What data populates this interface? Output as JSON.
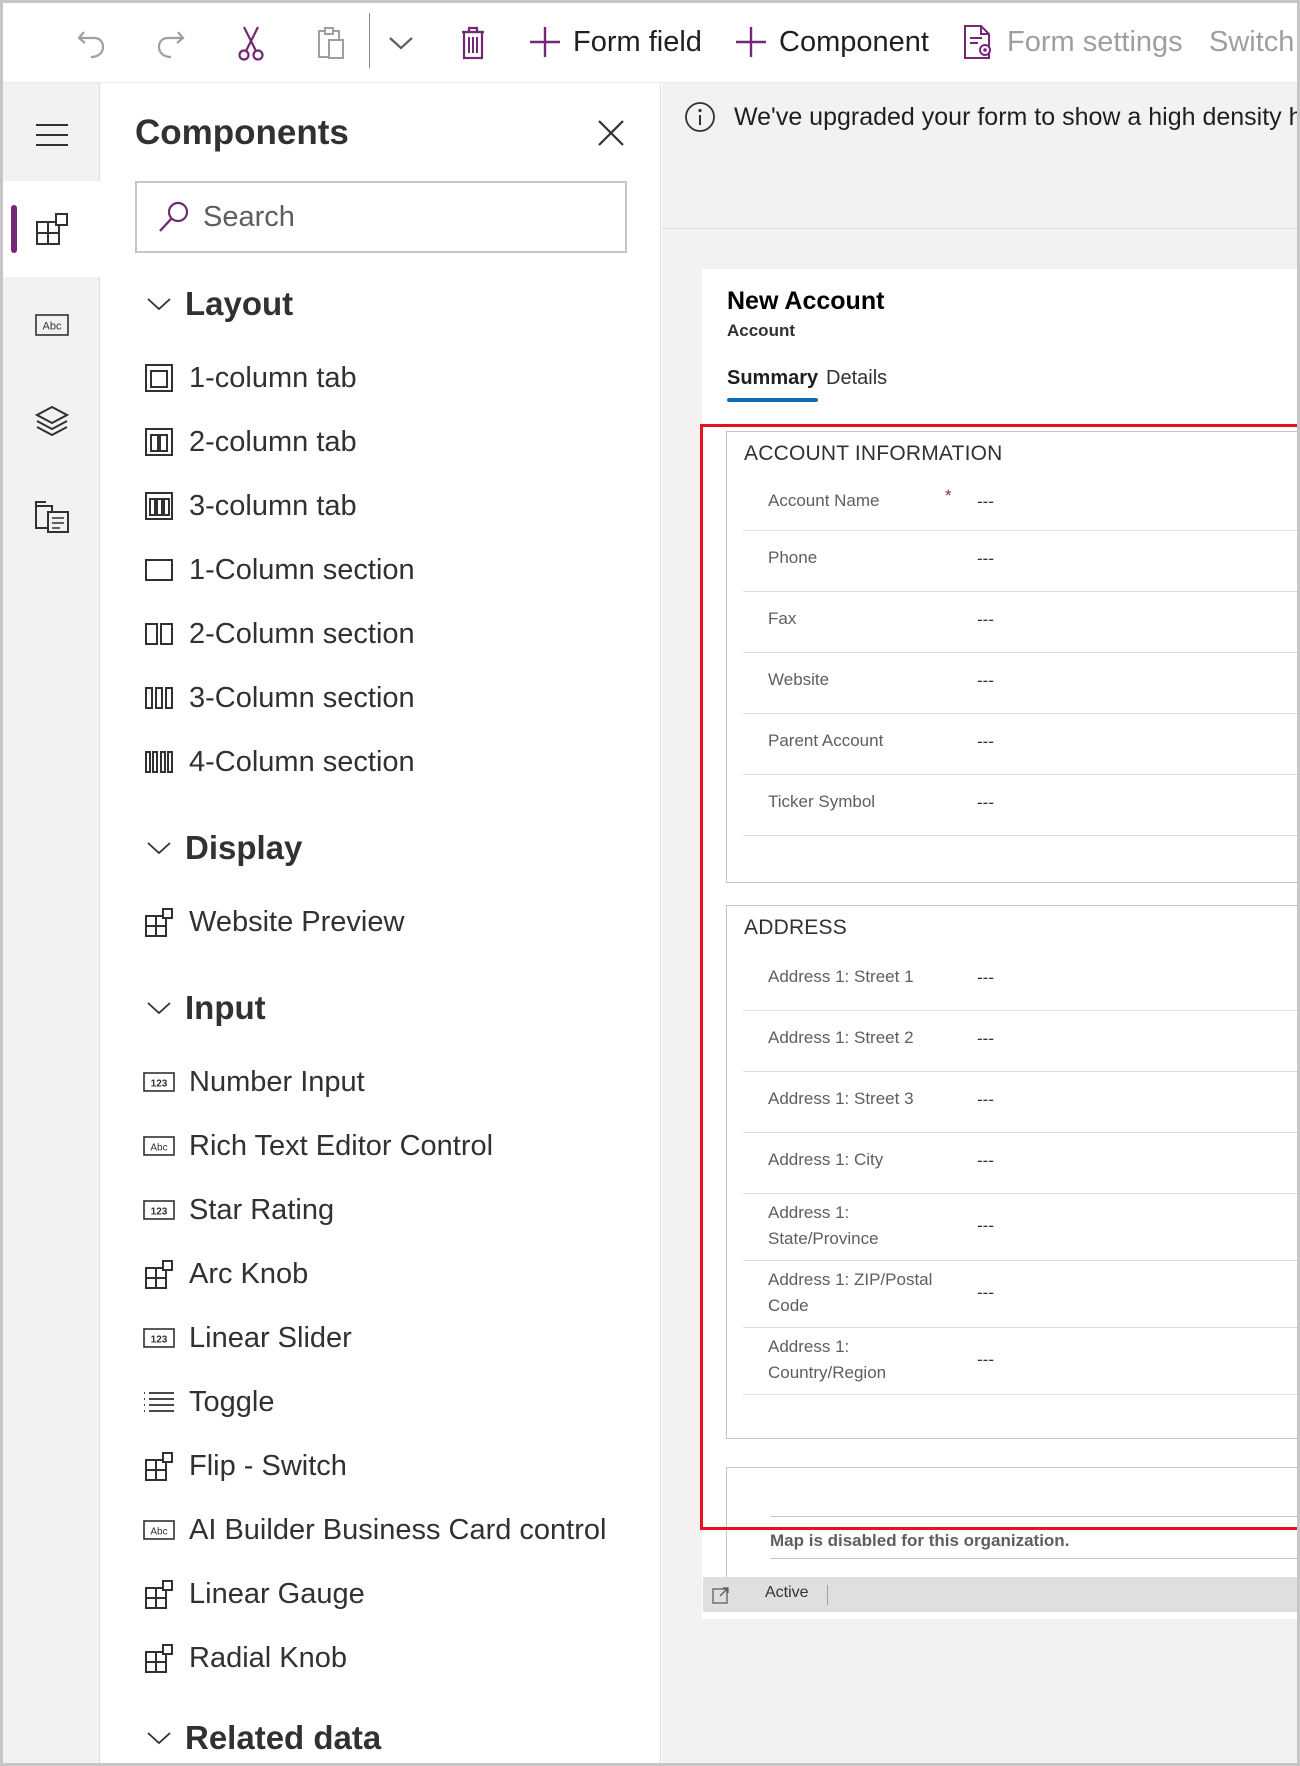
{
  "toolbar": {
    "form_field_label": "Form field",
    "component_label": "Component",
    "form_settings_label": "Form settings",
    "switch_label": "Switch t"
  },
  "rail": {
    "items": [
      {
        "icon": "menu-icon"
      },
      {
        "icon": "components-icon"
      },
      {
        "icon": "text-field-icon"
      },
      {
        "icon": "layers-icon"
      },
      {
        "icon": "form-library-icon"
      }
    ]
  },
  "panel": {
    "title": "Components",
    "search_placeholder": "Search",
    "categories": {
      "layout": "Layout",
      "display": "Display",
      "input": "Input",
      "related": "Related data"
    },
    "layout_items": [
      "1-column tab",
      "2-column tab",
      "3-column tab",
      "1-Column section",
      "2-Column section",
      "3-Column section",
      "4-Column section"
    ],
    "display_items": [
      "Website Preview"
    ],
    "input_items": [
      "Number Input",
      "Rich Text Editor Control",
      "Star Rating",
      "Arc Knob",
      "Linear Slider",
      "Toggle",
      "Flip - Switch",
      "AI Builder Business Card control",
      "Linear Gauge",
      "Radial Knob"
    ]
  },
  "banner": {
    "text": "We've upgraded your form to show a high density hea"
  },
  "form": {
    "title": "New Account",
    "entity": "Account",
    "tabs": [
      "Summary",
      "Details"
    ],
    "account_section": {
      "title": "ACCOUNT INFORMATION",
      "fields": [
        {
          "label": "Account Name",
          "value": "---",
          "required_mark": "*"
        },
        {
          "label": "Phone",
          "value": "---"
        },
        {
          "label": "Fax",
          "value": "---"
        },
        {
          "label": "Website",
          "value": "---"
        },
        {
          "label": "Parent Account",
          "value": "---"
        },
        {
          "label": "Ticker Symbol",
          "value": "---"
        }
      ]
    },
    "address_section": {
      "title": "ADDRESS",
      "fields": [
        {
          "label": "Address 1: Street 1",
          "value": "---"
        },
        {
          "label": "Address 1: Street 2",
          "value": "---"
        },
        {
          "label": "Address 1: Street 3",
          "value": "---"
        },
        {
          "label": "Address 1: City",
          "value": "---"
        },
        {
          "label": "Address 1: State/Province",
          "value": "---"
        },
        {
          "label": "Address 1: ZIP/Postal Code",
          "value": "---"
        },
        {
          "label": "Address 1: Country/Region",
          "value": "---"
        }
      ]
    },
    "map_message": "Map is disabled for this organization.",
    "status": "Active"
  },
  "colors": {
    "accent": "#742774",
    "tab_underline": "#0f6cbd",
    "highlight_border": "#e81123"
  }
}
